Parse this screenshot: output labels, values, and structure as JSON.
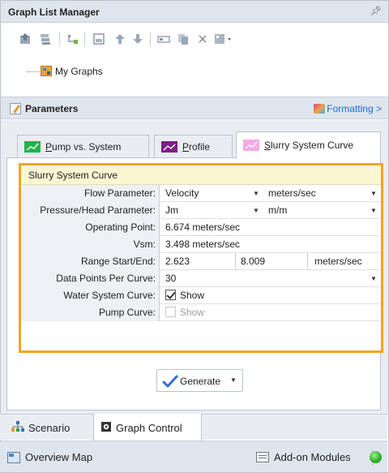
{
  "panel_title": "Graph List Manager",
  "pin_glyph": "⌂",
  "toolbar": {
    "icons": [
      "open-graph-icon",
      "stack-icon",
      "new-folder-icon",
      "image-icon",
      "move-up-icon",
      "move-down-icon",
      "rename-icon",
      "copy-icon",
      "delete-icon",
      "options-dropdown-icon"
    ]
  },
  "tree": {
    "root_label": "My Graphs"
  },
  "parameters": {
    "title": "Parameters",
    "formatting_link": "Formatting >"
  },
  "tabs": [
    {
      "accel": "P",
      "rest": "ump vs. System",
      "icon": "pump-system-icon"
    },
    {
      "accel": "P",
      "rest": "rofile",
      "icon": "profile-icon"
    },
    {
      "accel": "S",
      "rest": "lurry System Curve",
      "icon": "slurry-curve-icon",
      "active": true
    }
  ],
  "grid": {
    "header": "Slurry System Curve",
    "rows": {
      "flow": {
        "label": "Flow Parameter:",
        "value": "Velocity",
        "unit": "meters/sec"
      },
      "pressure": {
        "label": "Pressure/Head Parameter:",
        "value": "Jm",
        "unit": "m/m"
      },
      "operating": {
        "label": "Operating Point:",
        "value": "6.674 meters/sec"
      },
      "vsm": {
        "label": "Vsm:",
        "value": "3.498 meters/sec"
      },
      "range": {
        "label": "Range Start/End:",
        "start": "2.623",
        "end": "8.009",
        "unit": "meters/sec"
      },
      "points": {
        "label": "Data Points Per Curve:",
        "value": "30"
      },
      "water": {
        "label": "Water System Curve:",
        "check_label": "Show",
        "checked": true
      },
      "pump": {
        "label": "Pump Curve:",
        "check_label": "Show",
        "checked": false,
        "disabled": true
      }
    }
  },
  "generate_button": {
    "label": "Generate"
  },
  "bottom_tabs": [
    {
      "label": "Scenario",
      "icon": "scenario-tree-icon"
    },
    {
      "label": "Graph Control",
      "icon": "graph-control-icon",
      "active": true
    }
  ],
  "statusbar": {
    "overview": "Overview Map",
    "addon": "Add-on Modules"
  },
  "colors": {
    "highlight_border": "#f0a51e",
    "grid_header_bg": "#fdf6d3",
    "link_blue": "#1a6bd4",
    "status_ok": "#2fa82a"
  }
}
